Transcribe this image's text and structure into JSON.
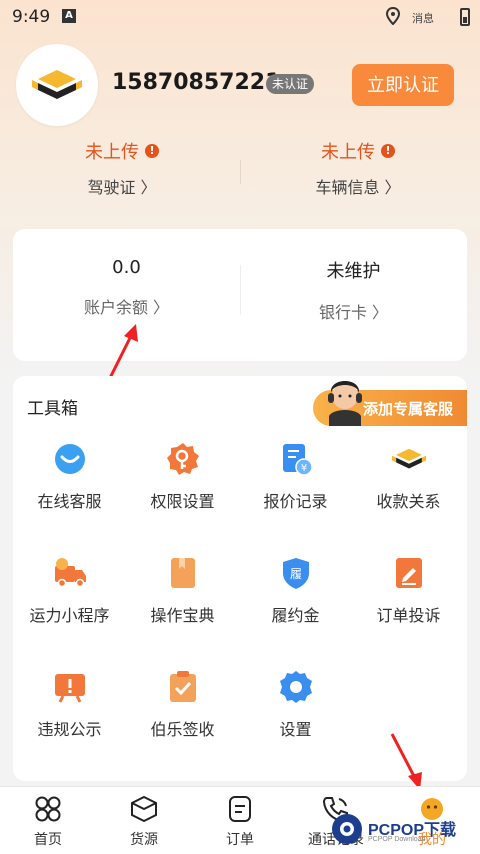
{
  "status_bar": {
    "time": "9:49",
    "network_text": "消息"
  },
  "profile": {
    "phone": "15870857221",
    "verify_badge": "未认证",
    "verify_button": "立即认证"
  },
  "documents": [
    {
      "status": "未上传",
      "label": "驾驶证 〉"
    },
    {
      "status": "未上传",
      "label": "车辆信息 〉"
    }
  ],
  "account": {
    "balance_value": "0.0",
    "balance_label": "账户余额 〉",
    "bank_value": "未维护",
    "bank_label": "银行卡 〉"
  },
  "toolbox": {
    "title": "工具箱",
    "service_button": "添加专属客服",
    "items": [
      {
        "label": "在线客服",
        "icon": "chat-icon"
      },
      {
        "label": "权限设置",
        "icon": "key-gear-icon"
      },
      {
        "label": "报价记录",
        "icon": "quote-record-icon"
      },
      {
        "label": "收款关系",
        "icon": "payment-logo-icon"
      },
      {
        "label": "运力小程序",
        "icon": "truck-icon"
      },
      {
        "label": "操作宝典",
        "icon": "book-icon"
      },
      {
        "label": "履约金",
        "icon": "shield-deposit-icon"
      },
      {
        "label": "订单投诉",
        "icon": "complaint-icon"
      },
      {
        "label": "违规公示",
        "icon": "alert-board-icon"
      },
      {
        "label": "伯乐签收",
        "icon": "clipboard-check-icon"
      },
      {
        "label": "设置",
        "icon": "settings-gear-icon"
      }
    ]
  },
  "nav": {
    "items": [
      {
        "label": "首页",
        "icon": "home-grid-icon"
      },
      {
        "label": "货源",
        "icon": "cargo-box-icon"
      },
      {
        "label": "订单",
        "icon": "order-icon"
      },
      {
        "label": "通话记录",
        "icon": "call-log-icon"
      },
      {
        "label": "我的",
        "icon": "profile-face-icon"
      }
    ],
    "active_index": 4
  },
  "watermark": {
    "text": "PCPOP下载",
    "sub": "PCPOP Download"
  },
  "colors": {
    "accent": "#f98a3c",
    "warning": "#e4531c"
  }
}
